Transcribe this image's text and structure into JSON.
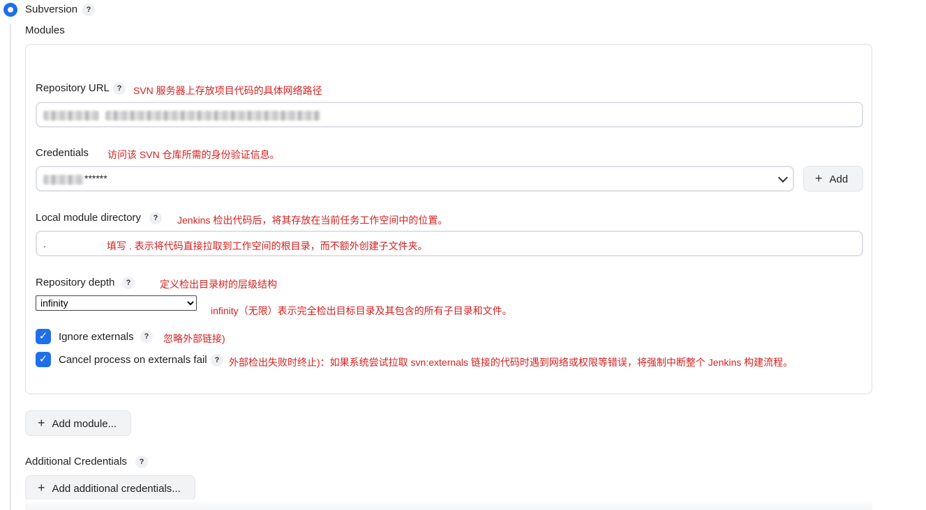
{
  "scm": {
    "option_label": "Subversion",
    "modules_label": "Modules"
  },
  "repository_url": {
    "label": "Repository URL",
    "note": "SVN 服务器上存放项目代码的具体网络路径"
  },
  "credentials": {
    "label": "Credentials",
    "note": "访问该 SVN 仓库所需的身份验证信息。",
    "value_masked": "******",
    "add_button": "Add"
  },
  "local_dir": {
    "label": "Local module directory",
    "note": "Jenkins 检出代码后，将其存放在当前任务工作空间中的位置。",
    "value": ".",
    "value_note": "填写 . 表示将代码直接拉取到工作空间的根目录，而不额外创建子文件夹。"
  },
  "depth": {
    "label": "Repository depth",
    "note": "定义检出目录树的层级结构",
    "selected": "infinity",
    "value_note": "infinity（无限）表示完全检出目标目录及其包含的所有子目录和文件。"
  },
  "ignore_externals": {
    "label": "Ignore externals",
    "note": "忽略外部链接)",
    "checked": true
  },
  "cancel_on_fail": {
    "label": "Cancel process on externals fail",
    "note": "外部检出失败时终止)：如果系统尝试拉取 svn:externals 链接的代码时遇到网络或权限等错误，将强制中断整个 Jenkins 构建流程。",
    "checked": true
  },
  "add_module_button": "Add module...",
  "additional_credentials": {
    "label": "Additional Credentials",
    "button": "Add additional credentials..."
  },
  "help_glyph": "?",
  "icons": {
    "plus": "+",
    "check": "✓",
    "dropdown": "chevron-down-icon"
  },
  "colors": {
    "accent": "#1f6feb",
    "annotation": "#d62020"
  }
}
